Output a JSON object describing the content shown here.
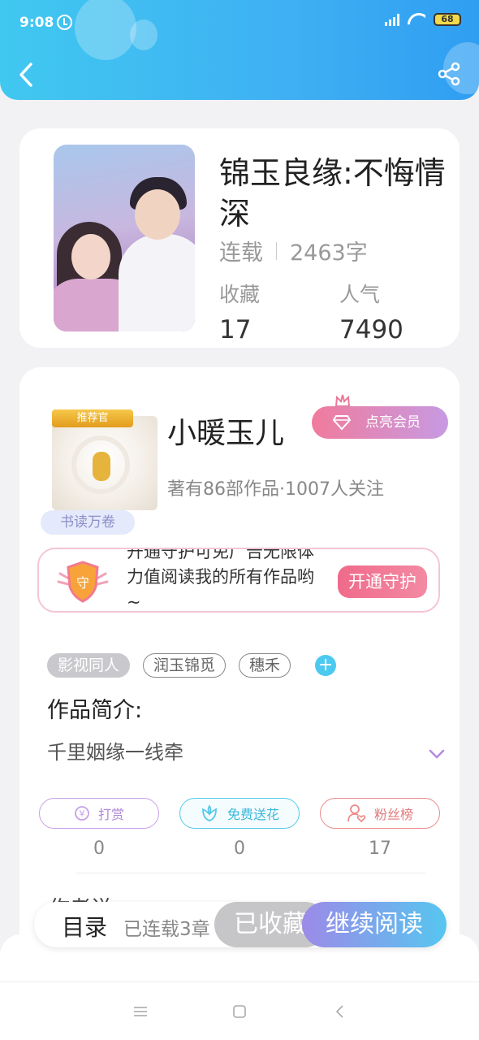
{
  "status_bar": {
    "time": "9:08",
    "battery": "68"
  },
  "book": {
    "title": "锦玉良缘:不悔情深",
    "status": "连载",
    "word_count": "2463字",
    "collect_label": "收藏",
    "collect_count": "17",
    "popularity_label": "人气",
    "popularity_count": "7490"
  },
  "author": {
    "ribbon": "推荐官",
    "reader_badge": "书读万卷",
    "name": "小暖玉儿",
    "vip_button": "点亮会员",
    "stats": "著有86部作品·1007人关注"
  },
  "guard": {
    "text": "开通守护可免广告无限体力值阅读我的所有作品哟~",
    "button": "开通守护"
  },
  "tags": [
    "影视同人",
    "润玉锦觅",
    "穗禾"
  ],
  "intro": {
    "title": "作品简介:",
    "text": "千里姻缘一线牵"
  },
  "actions": [
    {
      "label": "打赏",
      "count": "0",
      "color": "#c7a0e8"
    },
    {
      "label": "免费送花",
      "count": "0",
      "color": "#56c9e8"
    },
    {
      "label": "粉丝榜",
      "count": "17",
      "color": "#ec8a8a"
    }
  ],
  "author_says": "作者说",
  "bottom": {
    "toc": "目录",
    "chapters": "已连载3章",
    "favorited": "已收藏",
    "continue": "继续阅读"
  }
}
